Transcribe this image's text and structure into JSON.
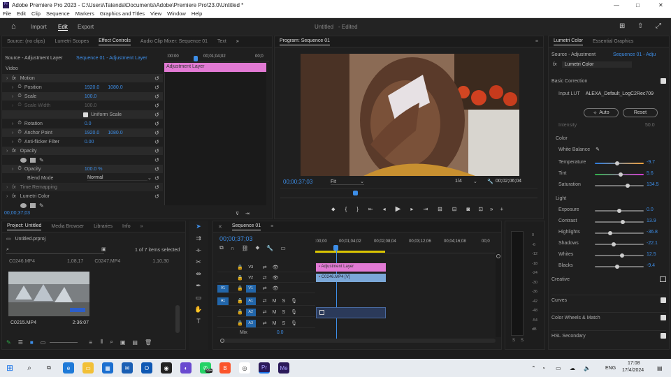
{
  "window": {
    "title": "Adobe Premiere Pro 2023 - C:\\Users\\Tatenda\\Documents\\Adobe\\Premiere Pro\\23.0\\Untitled *",
    "min": "—",
    "max": "□",
    "close": "✕"
  },
  "menu": [
    "File",
    "Edit",
    "Clip",
    "Sequence",
    "Markers",
    "Graphics and Titles",
    "View",
    "Window",
    "Help"
  ],
  "header": {
    "import": "Import",
    "edit": "Edit",
    "export": "Export",
    "project_title": "Untitled",
    "edited": "- Edited"
  },
  "effect_controls": {
    "tabs": [
      "Source: (no clips)",
      "Lumetri Scopes",
      "Effect Controls",
      "Audio Clip Mixer: Sequence 01",
      "Text"
    ],
    "source_label": "Source - Adjustment Layer",
    "seq_label": "Sequence 01 - Adjustment Layer",
    "ruler_start": ":00:00",
    "ruler_mid": "00;01;04;02",
    "ruler_end": "00;0",
    "clip_label": "Adjustment Layer",
    "section_video": "Video",
    "motion": "Motion",
    "position": "Position",
    "pos_x": "1920.0",
    "pos_y": "1080.0",
    "scale": "Scale",
    "scale_val": "100.0",
    "scale_width": "Scale Width",
    "scale_width_val": "100.0",
    "uniform_scale": "Uniform Scale",
    "rotation": "Rotation",
    "rotation_val": "0.0",
    "anchor": "Anchor Point",
    "anchor_x": "1920.0",
    "anchor_y": "1080.0",
    "flicker": "Anti-flicker Filter",
    "flicker_val": "0.00",
    "opacity": "Opacity",
    "opacity_inner": "Opacity",
    "opacity_val": "100.0 %",
    "blend": "Blend Mode",
    "blend_val": "Normal",
    "time_remap": "Time Remapping",
    "lumetri": "Lumetri Color",
    "timecode": "00;00;37;03"
  },
  "program": {
    "tab": "Program: Sequence 01",
    "timecode": "00;00;37;03",
    "fit": "Fit",
    "fraction": "1/4",
    "duration": "00;02;06;04"
  },
  "project": {
    "tabs": [
      "Project: Untitled",
      "Media Browser",
      "Libraries",
      "Info"
    ],
    "file": "Untitled.prproj",
    "items_count": "1 of 7 items selected",
    "row_name": "C0246.MP4",
    "row_c1": "1,08,17",
    "row_c2": "C0247.MP4",
    "row_c3": "1,10,30",
    "thumb_name": "C0215.MP4",
    "thumb_dur": "2:36:07"
  },
  "timeline": {
    "tab": "Sequence 01",
    "timecode": "00;00;37;03",
    "ruler": [
      ":00;00",
      "00;01;04;02",
      "00;02;08;04",
      "00;03;12;06",
      "00;04;16;08",
      "00;0"
    ],
    "v3": "V3",
    "v2": "V2",
    "v1": "V1",
    "a1": "A1",
    "a2": "A2",
    "a3": "A3",
    "mix": "Mix",
    "mix_val": "0.0",
    "v1_src": "V1",
    "a1_src": "A1",
    "clip_adj": "Adjustment Layer",
    "clip_vid": "C0246.MP4 [V]",
    "meter_ticks": [
      "0",
      "-6",
      "-12",
      "-18",
      "-24",
      "-30",
      "-36",
      "-42",
      "-48",
      "-54",
      "dB"
    ],
    "s_left": "S",
    "s_right": "S"
  },
  "lumetri": {
    "tabs": [
      "Lumetri Color",
      "Essential Graphics"
    ],
    "source": "Source - Adjustment",
    "seq": "Sequence 01 - Adju",
    "fx": "Lumetri Color",
    "basic": "Basic Correction",
    "input_lut_label": "Input LUT",
    "input_lut": "ALEXA_Default_LogC2Rec709",
    "auto": "Auto",
    "reset": "Reset",
    "intensity": "Intensity",
    "intensity_val": "50.0",
    "color": "Color",
    "white_balance": "White Balance",
    "temperature": "Temperature",
    "temperature_val": "-9.7",
    "tint": "Tint",
    "tint_val": "5.6",
    "saturation": "Saturation",
    "saturation_val": "134.5",
    "light": "Light",
    "exposure": "Exposure",
    "exposure_val": "0.0",
    "contrast": "Contrast",
    "contrast_val": "13.9",
    "highlights": "Highlights",
    "highlights_val": "-36.8",
    "shadows": "Shadows",
    "shadows_val": "-22.1",
    "whites": "Whites",
    "whites_val": "12.5",
    "blacks": "Blacks",
    "blacks_val": "-9.4",
    "creative": "Creative",
    "curves": "Curves",
    "wheels": "Color Wheels & Match",
    "hsl": "HSL Secondary"
  },
  "taskbar": {
    "lang": "ENG",
    "time": "17:08",
    "date": "17/4/2024",
    "badge": "99+"
  }
}
